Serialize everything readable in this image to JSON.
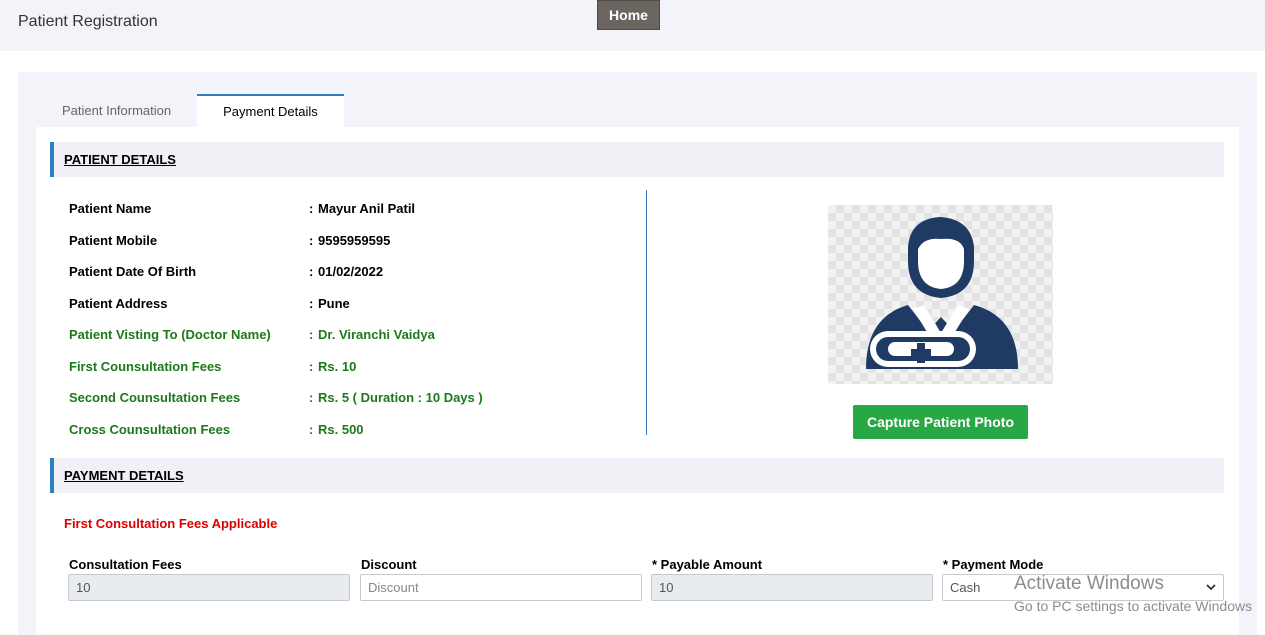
{
  "header": {
    "title": "Patient Registration",
    "home_label": "Home"
  },
  "tabs": [
    {
      "label": "Patient Information",
      "active": false
    },
    {
      "label": "Payment Details",
      "active": true
    }
  ],
  "patient_details": {
    "heading": "PATIENT DETAILS",
    "separator": ":",
    "rows": [
      {
        "label": "Patient Name",
        "value": "Mayur Anil Patil"
      },
      {
        "label": "Patient Mobile",
        "value": "9595959595"
      },
      {
        "label": "Patient Date Of Birth",
        "value": "01/02/2022"
      },
      {
        "label": "Patient Address",
        "value": "Pune"
      },
      {
        "label": "Patient Visting To (Doctor Name)",
        "value": "Dr. Viranchi Vaidya"
      },
      {
        "label": "First Counsultation Fees",
        "value": "Rs. 10"
      },
      {
        "label": "Second Counsultation Fees",
        "value": "Rs. 5 ( Duration : 10 Days )"
      },
      {
        "label": "Cross Counsultation Fees",
        "value": "Rs. 500"
      }
    ],
    "photo_icon": "doctor-avatar-icon",
    "capture_button": "Capture Patient Photo"
  },
  "payment_details": {
    "heading": "PAYMENT DETAILS",
    "notice": "First Consultation Fees Applicable",
    "fields": {
      "consultation_fees": {
        "label": "Consultation Fees",
        "value": "10"
      },
      "discount": {
        "label": "Discount",
        "value": "",
        "placeholder": "Discount"
      },
      "payable_amount": {
        "label": "* Payable Amount",
        "value": "10"
      },
      "payment_mode": {
        "label": "* Payment Mode",
        "value": "Cash"
      }
    }
  },
  "watermark": {
    "line1": "Activate Windows",
    "line2": "Go to PC settings to activate Windows"
  },
  "colors": {
    "accent": "#2d7fc1",
    "green_text": "#1b7a1b",
    "notice_red": "#dd0000",
    "capture_button": "#28a745",
    "home_button": "#6b6560"
  }
}
